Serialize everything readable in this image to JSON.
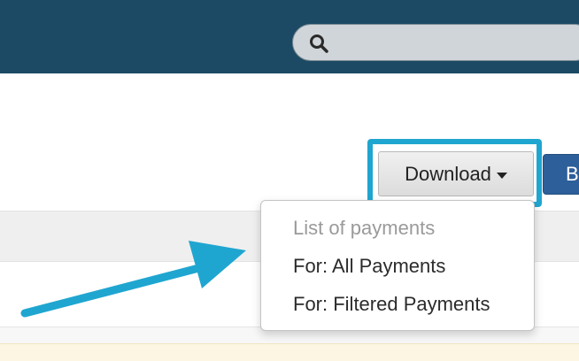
{
  "header": {
    "search": {
      "icon": "search-icon",
      "placeholder": "",
      "value": ""
    }
  },
  "toolbar": {
    "download_label": "Download",
    "download_icon": "caret-down-icon",
    "next_button_label": "B"
  },
  "download_menu": {
    "header": "List of payments",
    "items": [
      {
        "label": "For: All Payments"
      },
      {
        "label": "For: Filtered Payments"
      }
    ]
  },
  "colors": {
    "header_bg": "#1c4a64",
    "highlight": "#1fa6d0",
    "primary_button": "#2d5f9a"
  }
}
